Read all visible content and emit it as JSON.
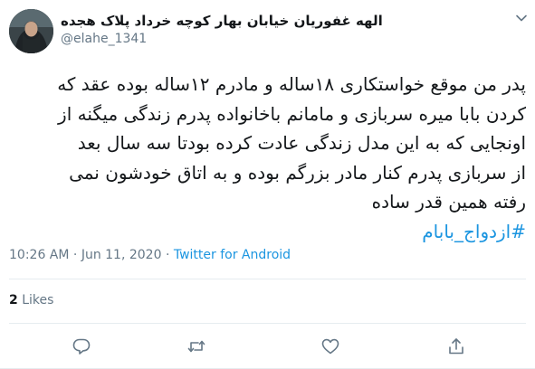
{
  "user": {
    "display_name": "الهه غفوریان خیابان بهار کوچه خرداد پلاک هجده",
    "username": "@elahe_1341",
    "avatar_icon": "profile-photo"
  },
  "tweet": {
    "lines": [
      "پدر من موقع خواستکاری ۱۸ساله و مادرم ۱۲ساله بوده عقد که",
      "کردن بابا میره سربازی و مامانم باخانواده پدرم زندگی میگنه از",
      "اونجایی که به این مدل زندگی عادت کرده بودتا سه سال بعد",
      "از سربازی پدرم کنار مادر بزرگم  بوده و به اتاق خودشون نمی",
      "رفته همین قدر ساده"
    ],
    "hashtag": "#ازدواج_بابام"
  },
  "meta": {
    "time": "10:26 AM",
    "separator": "·",
    "date": "Jun 11, 2020",
    "source": "Twitter for Android"
  },
  "likes": {
    "count": "2",
    "label": "Likes"
  },
  "actions": [
    {
      "name": "reply-icon"
    },
    {
      "name": "retweet-icon"
    },
    {
      "name": "like-icon"
    },
    {
      "name": "share-icon"
    }
  ],
  "colors": {
    "text": "#14171a",
    "secondary": "#657786",
    "link": "#1b95e0",
    "divider": "#e6ecf0"
  }
}
